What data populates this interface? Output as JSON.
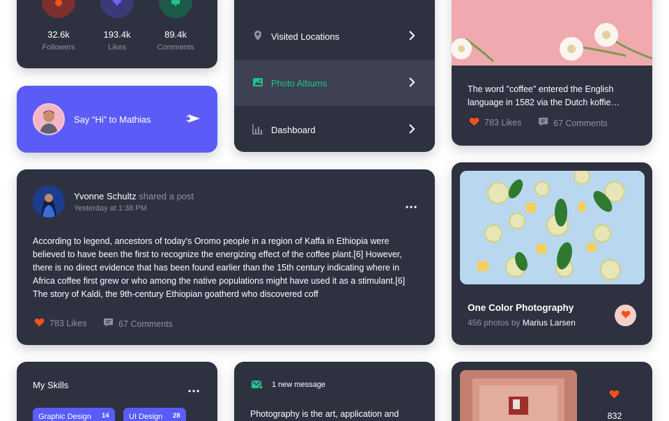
{
  "stats": {
    "items": [
      {
        "value": "32.6k",
        "label": "Followers",
        "color": "#7d2f2f",
        "icon": "user-icon"
      },
      {
        "value": "193.4k",
        "label": "Likes",
        "color": "#3b3a78",
        "icon": "heart-icon"
      },
      {
        "value": "89.4k",
        "label": "Comments",
        "color": "#1d5a4a",
        "icon": "chat-icon"
      }
    ]
  },
  "say_hi": {
    "text": "Say “Hi” to Mathias",
    "color": "#5b5cf7",
    "icon": "send-icon"
  },
  "menu": {
    "items": [
      {
        "label": "Visited Locations",
        "icon": "location-pin-icon",
        "active": false
      },
      {
        "label": "Photo Albums",
        "icon": "photo-icon",
        "active": true
      },
      {
        "label": "Dashboard",
        "icon": "bar-chart-icon",
        "active": false
      }
    ],
    "active_color": "#1fc488"
  },
  "coffee_card": {
    "text": "The word \"coffee\" entered the English language in 1582 via the Dutch koffie…",
    "likes": "783 Likes",
    "comments": "67 Comments"
  },
  "post": {
    "author": "Yvonne Schultz",
    "action": "shared a post",
    "time": "Yesterday at 1:38 PM",
    "body": "According to legend, ancestors of today's Oromo people in a region of Kaffa in Ethiopia were believed to have been the first to recognize the energizing effect of the coffee plant.[6] However, there is no direct evidence that has been found earlier than the 15th century indicating where in Africa coffee first grew or who among the native populations might have used it as a stimulant.[6] The story of Kaldi, the 9th-century Ethiopian goatherd who discovered coff",
    "likes": "783 Likes",
    "comments": "67 Comments"
  },
  "album": {
    "title": "One Color Photography",
    "photos_prefix": "456 photos by",
    "author": "Marius Larsen"
  },
  "skills": {
    "title": "My Skills",
    "items": [
      {
        "label": "Graphic Design",
        "count": "14"
      },
      {
        "label": "UI Design",
        "count": "28"
      }
    ]
  },
  "message": {
    "notice": "1 new message",
    "body": "Photography is the art, application and"
  },
  "room": {
    "count": "832"
  },
  "colors": {
    "card": "#2e3140",
    "accent_red": "#f4511e",
    "muted": "#8e92a3",
    "purple": "#5b5cf7"
  }
}
